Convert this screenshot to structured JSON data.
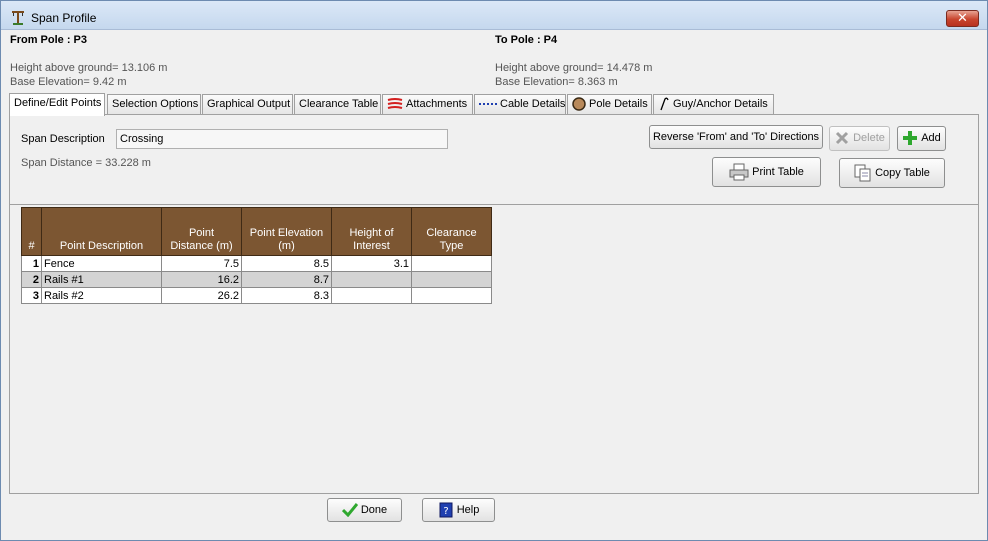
{
  "window": {
    "title": "Span Profile",
    "close_label": "✕"
  },
  "from_pole": {
    "title": "From Pole : P3",
    "height": "Height above ground= 13.106 m",
    "elevation": "Base Elevation= 9.42 m"
  },
  "to_pole": {
    "title": "To Pole : P4",
    "height": "Height above ground= 14.478 m",
    "elevation": "Base Elevation= 8.363 m"
  },
  "tabs": [
    {
      "label": "Define/Edit Points",
      "active": true
    },
    {
      "label": "Selection Options"
    },
    {
      "label": "Graphical Output"
    },
    {
      "label": "Clearance Table"
    },
    {
      "label": "Attachments",
      "icon": "attachments-icon"
    },
    {
      "label": "Cable Details",
      "icon": "cable-icon"
    },
    {
      "label": "Pole Details",
      "icon": "pole-icon"
    },
    {
      "label": "Guy/Anchor Details",
      "icon": "guy-anchor-icon"
    }
  ],
  "span": {
    "desc_label": "Span Description",
    "desc_value": "Crossing",
    "distance": "Span Distance = 33.228 m"
  },
  "buttons": {
    "reverse": "Reverse 'From' and 'To' Directions",
    "delete": "Delete",
    "add": "Add",
    "print": "Print Table",
    "copy": "Copy Table",
    "done": "Done",
    "help": "Help"
  },
  "grid": {
    "columns": [
      "#",
      "Point Description",
      "Point\nDistance (m)",
      "Point Elevation\n(m)",
      "Height of\nInterest",
      "Clearance\nType"
    ],
    "rows": [
      {
        "n": "1",
        "desc": "Fence",
        "dist": "7.5",
        "elev": "8.5",
        "hoi": "3.1",
        "type": ""
      },
      {
        "n": "2",
        "desc": "Rails #1",
        "dist": "16.2",
        "elev": "8.7",
        "hoi": "",
        "type": ""
      },
      {
        "n": "3",
        "desc": "Rails #2",
        "dist": "26.2",
        "elev": "8.3",
        "hoi": "",
        "type": ""
      }
    ]
  },
  "colors": {
    "header_brown": "#7c5632",
    "alt_row": "#d4d4d4"
  }
}
